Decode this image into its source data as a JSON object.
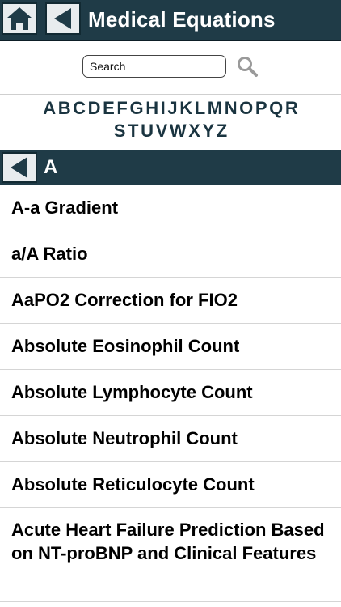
{
  "header": {
    "title": "Medical Equations"
  },
  "search": {
    "placeholder": "Search"
  },
  "alphabet": {
    "row1": [
      "A",
      "B",
      "C",
      "D",
      "E",
      "F",
      "G",
      "H",
      "I",
      "J",
      "K",
      "L",
      "M",
      "N",
      "O",
      "P",
      "Q",
      "R"
    ],
    "row2": [
      "S",
      "T",
      "U",
      "V",
      "W",
      "X",
      "Y",
      "Z"
    ]
  },
  "section": {
    "title": "A"
  },
  "items": [
    "A-a Gradient",
    "a/A Ratio",
    "AaPO2 Correction for FIO2",
    "Absolute Eosinophil Count",
    "Absolute Lymphocyte Count",
    "Absolute Neutrophil Count",
    "Absolute Reticulocyte Count",
    "Acute Heart Failure Prediction Based on NT-proBNP and Clinical Features"
  ],
  "colors": {
    "bar": "#1f3b47",
    "letters": "#1a3440"
  },
  "icons": [
    "home-icon",
    "back-arrow-icon",
    "search-icon"
  ]
}
